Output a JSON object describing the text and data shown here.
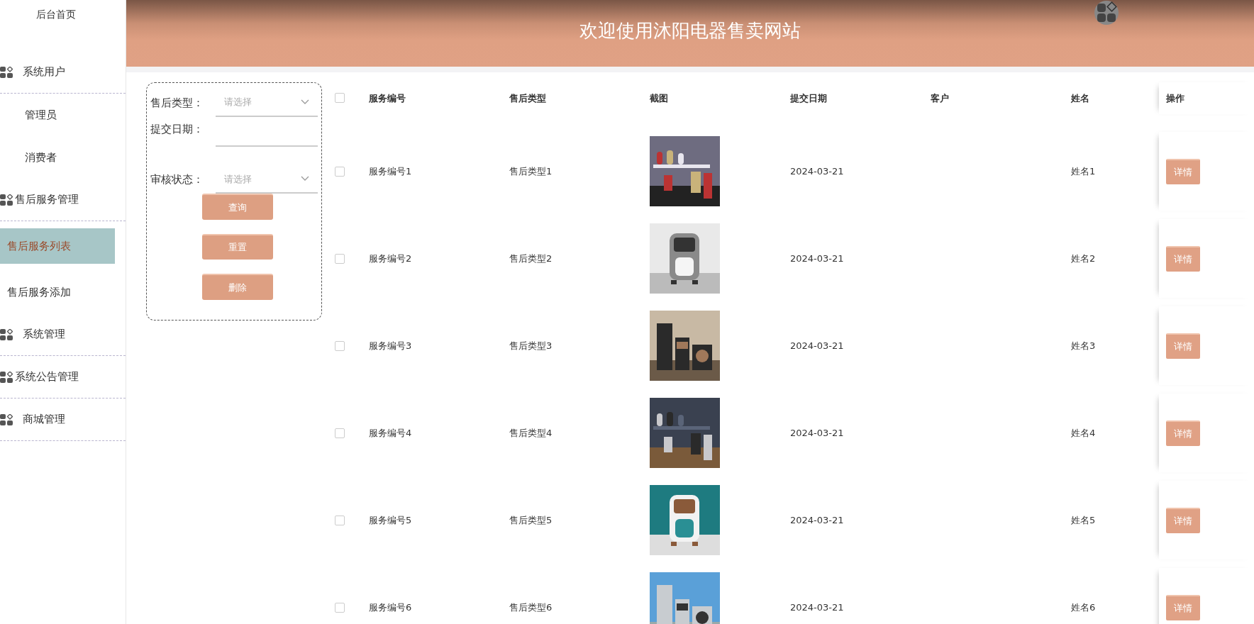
{
  "sidebar": {
    "items": [
      {
        "kind": "link",
        "label": "后台首页",
        "selected": false
      },
      {
        "kind": "group",
        "label": "系统用户",
        "selected": false
      },
      {
        "kind": "sub",
        "label": "管理员",
        "selected": false
      },
      {
        "kind": "sub",
        "label": "消费者",
        "selected": false
      },
      {
        "kind": "group",
        "label": "售后服务管理",
        "selected": false
      },
      {
        "kind": "sub",
        "label": "售后服务列表",
        "selected": true
      },
      {
        "kind": "sub",
        "label": "售后服务添加",
        "selected": false
      },
      {
        "kind": "group",
        "label": "系统管理",
        "selected": false
      },
      {
        "kind": "group",
        "label": "系统公告管理",
        "selected": false
      },
      {
        "kind": "group",
        "label": "商城管理",
        "selected": false
      }
    ]
  },
  "header": {
    "title": "欢迎使用沐阳电器售卖网站"
  },
  "filter": {
    "fields": [
      {
        "kind": "select",
        "label": "售后类型：",
        "placeholder": "请选择"
      },
      {
        "kind": "date",
        "label": "提交日期："
      },
      {
        "kind": "select",
        "label": "审核状态：",
        "placeholder": "请选择"
      }
    ],
    "buttons": [
      "查询",
      "重置",
      "删除"
    ]
  },
  "table": {
    "select_all": {
      "checked": false
    },
    "columns": [
      "服务编号",
      "售后类型",
      "截图",
      "提交日期",
      "客户",
      "姓名",
      "操作"
    ],
    "rows": [
      {
        "checked": false,
        "service_no": "服务编号1",
        "type": "售后类型1",
        "date": "2024-03-21",
        "name": "姓名1",
        "action": "详情"
      },
      {
        "checked": false,
        "service_no": "服务编号2",
        "type": "售后类型2",
        "date": "2024-03-21",
        "name": "姓名2",
        "action": "详情"
      },
      {
        "checked": false,
        "service_no": "服务编号3",
        "type": "售后类型3",
        "date": "2024-03-21",
        "name": "姓名3",
        "action": "详情"
      },
      {
        "checked": false,
        "service_no": "服务编号4",
        "type": "售后类型4",
        "date": "2024-03-21",
        "name": "姓名4",
        "action": "详情"
      },
      {
        "checked": false,
        "service_no": "服务编号5",
        "type": "售后类型5",
        "date": "2024-03-21",
        "name": "姓名5",
        "action": "详情"
      },
      {
        "checked": false,
        "service_no": "服务编号6",
        "type": "售后类型6",
        "date": "2024-03-21",
        "name": "姓名6",
        "action": "详情"
      }
    ]
  }
}
